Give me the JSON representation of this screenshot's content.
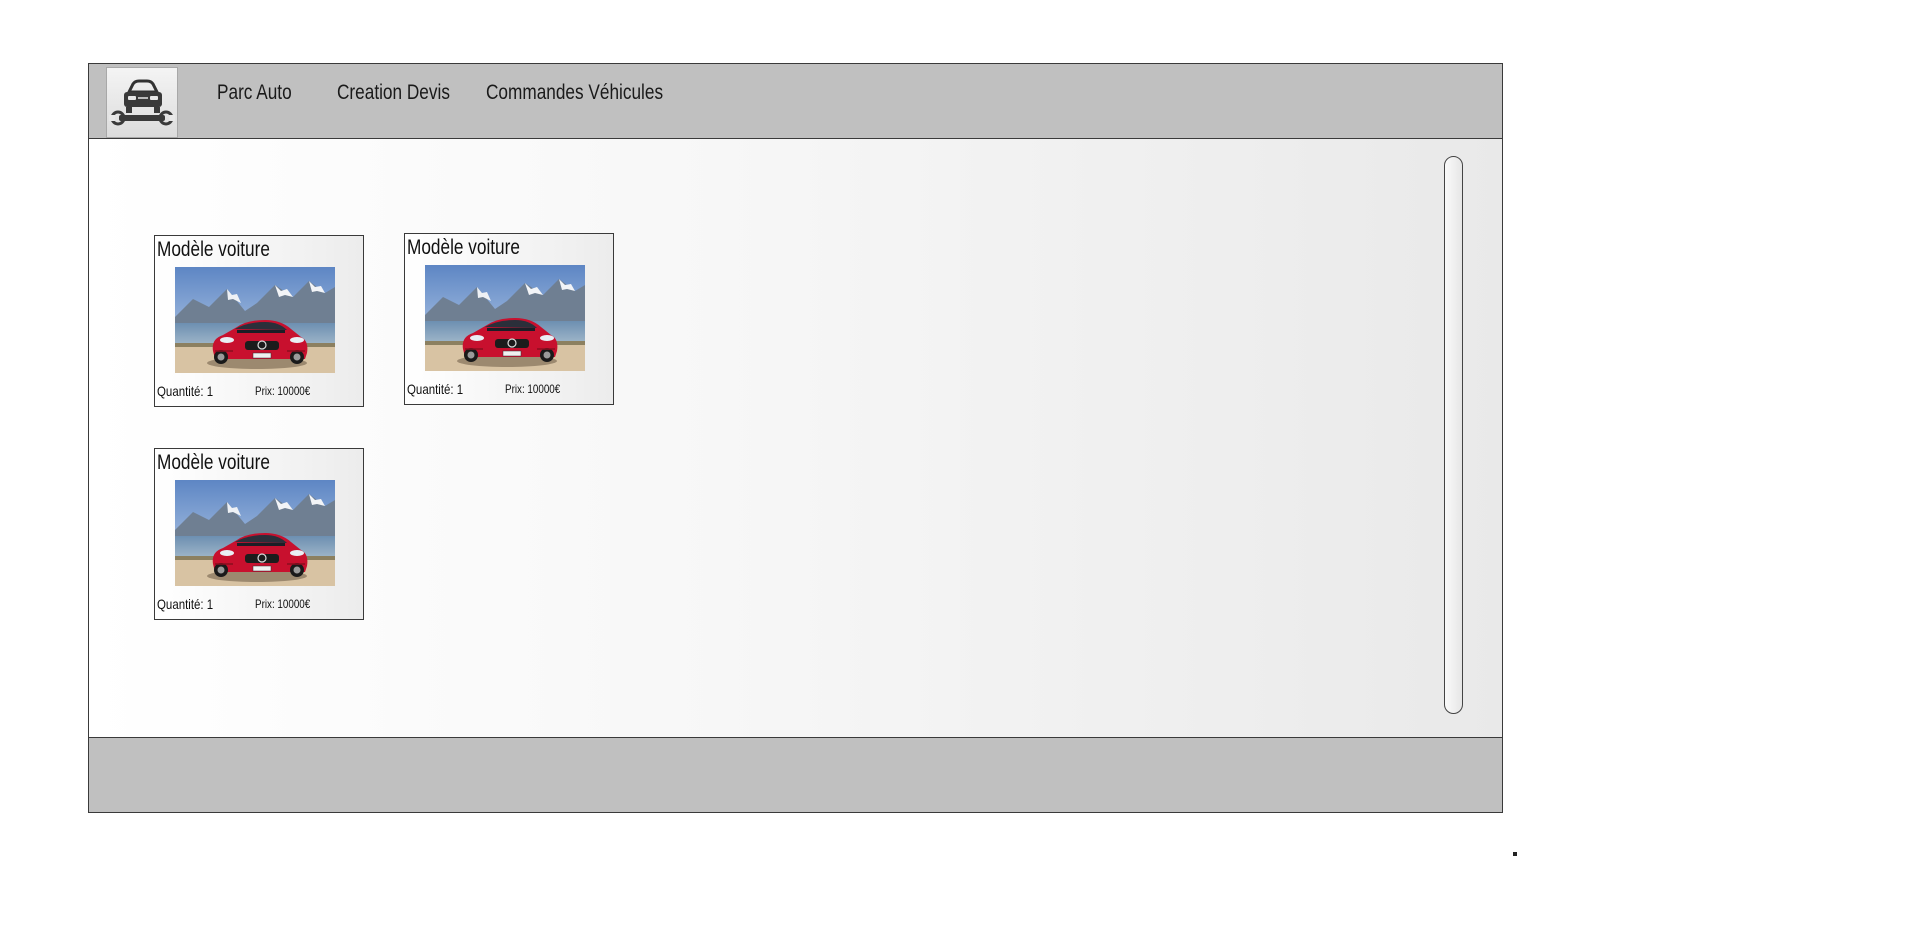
{
  "navbar": {
    "logo_icon": "car-repair-icon",
    "items": [
      {
        "label": "Parc Auto"
      },
      {
        "label": "Creation Devis"
      },
      {
        "label": "Commandes Véhicules"
      }
    ]
  },
  "cards": [
    {
      "title": "Modèle voiture",
      "quantity": "Quantité: 1",
      "price": "Prix: 10000€",
      "image_icon": "red-car-photo"
    },
    {
      "title": "Modèle voiture",
      "quantity": "Quantité: 1",
      "price": "Prix: 10000€",
      "image_icon": "red-car-photo"
    },
    {
      "title": "Modèle voiture",
      "quantity": "Quantité: 1",
      "price": "Prix: 10000€",
      "image_icon": "red-car-photo"
    }
  ],
  "colors": {
    "bar_background": "#c0c0c0",
    "border": "#3a3a3a",
    "car_red": "#c8102e"
  }
}
